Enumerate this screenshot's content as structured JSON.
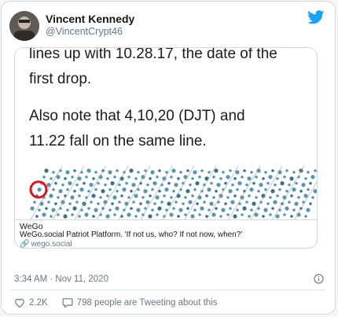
{
  "author": {
    "name": "Vincent Kennedy",
    "handle": "@VincentCrypt46"
  },
  "icons": {
    "brand": "twitter-bird-icon",
    "info": "info-icon",
    "like": "heart-icon",
    "comment": "comment-bubble-icon",
    "link": "link-icon"
  },
  "colors": {
    "brand": "#1da1f2",
    "text": "#14171a",
    "muted": "#657786",
    "border": "#cfd9de",
    "highlight_circle": "#d0191c"
  },
  "card": {
    "image_text": {
      "line1": "lines up with 10.28.17, the date of the",
      "line2": "first drop.",
      "line3": "Also note that 4,10,20 (DJT) and",
      "line4": "11.22 fall on the same line."
    },
    "site": "WeGo",
    "description": "WeGo.social Patriot Platform. 'If not us, who? If not now, when?'",
    "url": "wego.social"
  },
  "timestamp": "3:34 AM · Nov 11, 2020",
  "stats": {
    "likes": "2.2K",
    "tweeting": "798 people are Tweeting about this"
  }
}
